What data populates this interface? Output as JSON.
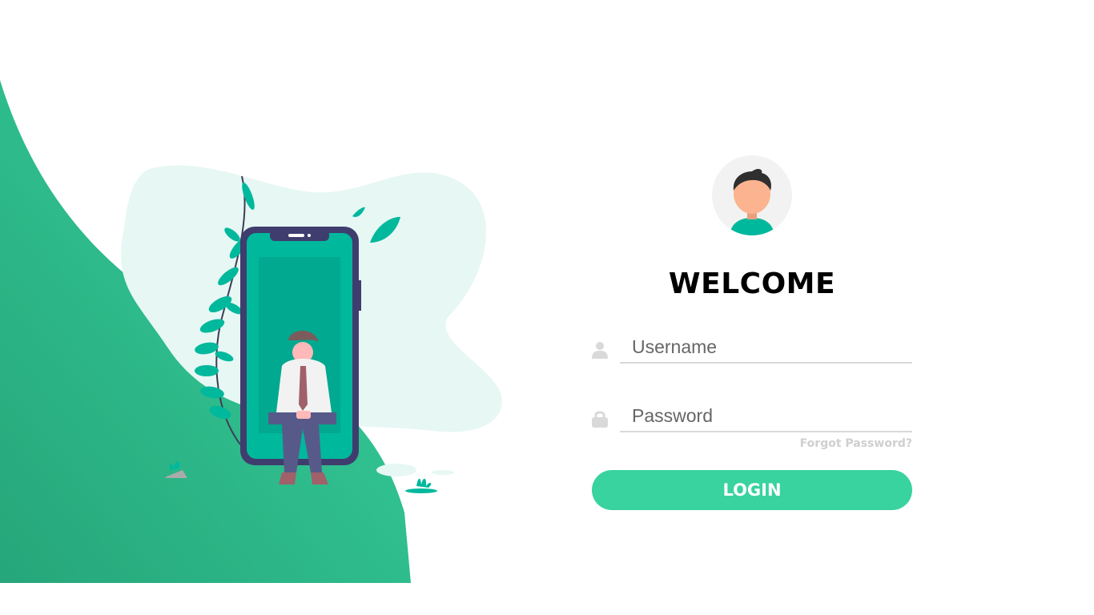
{
  "login": {
    "title": "WELCOME",
    "username_placeholder": "Username",
    "password_placeholder": "Password",
    "forgot_label": "Forgot Password?",
    "login_label": "LOGIN"
  },
  "icons": {
    "username": "user-icon",
    "password": "lock-icon",
    "avatar": "avatar-icon"
  },
  "colors": {
    "accent": "#38d39f",
    "wave_dark": "#26a67a",
    "blob": "#e6f7f4",
    "phone": "#3f3d6e",
    "phone_screen": "#00b89c"
  }
}
